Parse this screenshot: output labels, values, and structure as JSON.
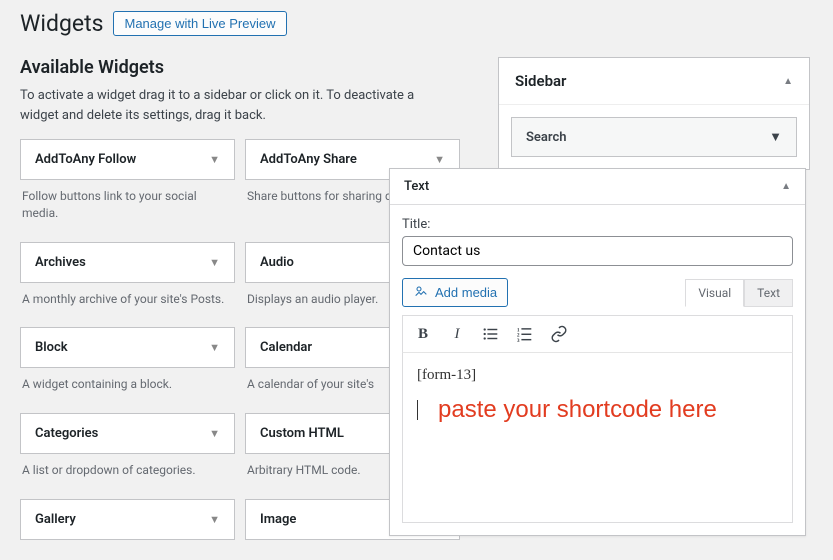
{
  "header": {
    "title": "Widgets",
    "manage_button": "Manage with Live Preview"
  },
  "available": {
    "title": "Available Widgets",
    "description": "To activate a widget drag it to a sidebar or click on it. To deactivate a widget and delete its settings, drag it back.",
    "items": [
      {
        "name": "AddToAny Follow",
        "desc": "Follow buttons link to your social media."
      },
      {
        "name": "AddToAny Share",
        "desc": "Share buttons for sharing content."
      },
      {
        "name": "Archives",
        "desc": "A monthly archive of your site's Posts."
      },
      {
        "name": "Audio",
        "desc": "Displays an audio player."
      },
      {
        "name": "Block",
        "desc": "A widget containing a block."
      },
      {
        "name": "Calendar",
        "desc": "A calendar of your site's"
      },
      {
        "name": "Categories",
        "desc": "A list or dropdown of categories."
      },
      {
        "name": "Custom HTML",
        "desc": "Arbitrary HTML code."
      },
      {
        "name": "Gallery",
        "desc": ""
      },
      {
        "name": "Image",
        "desc": ""
      }
    ]
  },
  "sidebar": {
    "title": "Sidebar",
    "widgets": [
      {
        "name": "Search"
      }
    ]
  },
  "text_widget": {
    "header": "Text",
    "title_label": "Title:",
    "title_value": "Contact us",
    "add_media": "Add media",
    "tab_visual": "Visual",
    "tab_text": "Text",
    "content_shortcode": "[form-13]",
    "annotation": "paste your shortcode here"
  }
}
